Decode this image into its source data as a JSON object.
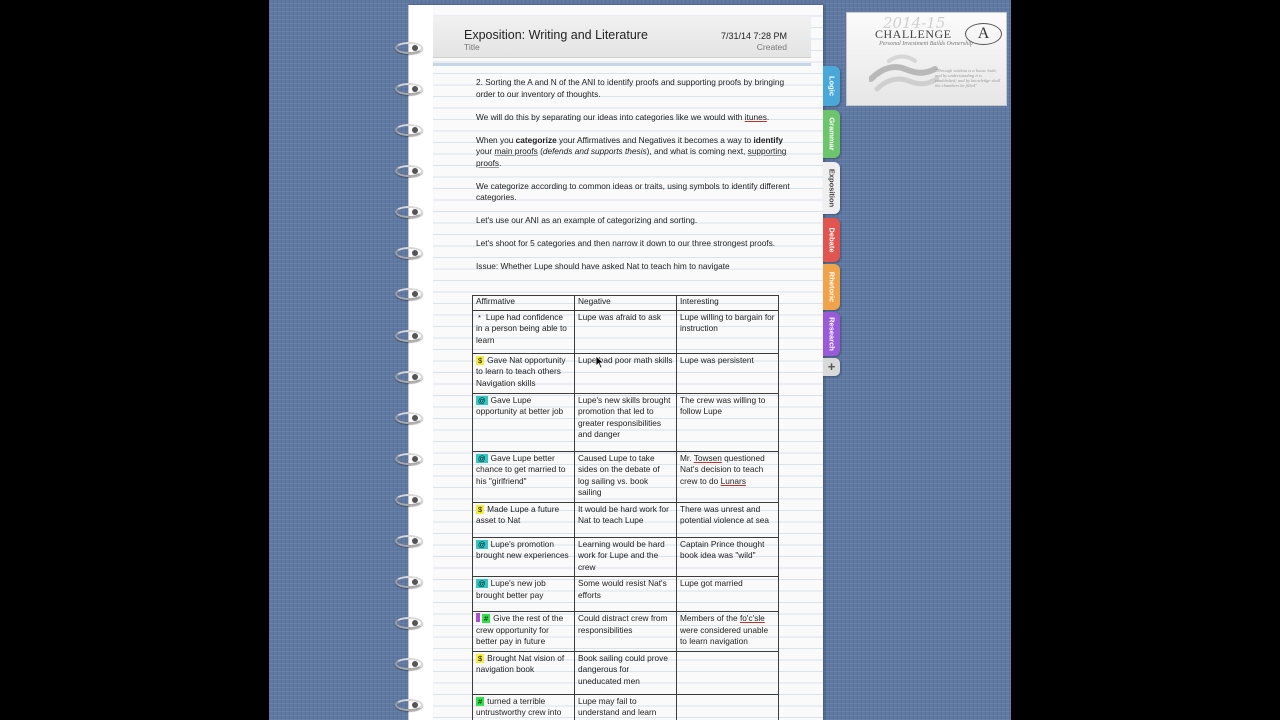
{
  "note": {
    "title": "Exposition:  Writing and Literature",
    "title_label": "Title",
    "created_value": "7/31/14 7:28 PM",
    "created_label": "Created"
  },
  "body": {
    "p1": "2.  Sorting the A and N of the ANI to identify proofs and supporting proofs by bringing order to our inventory of thoughts.",
    "p2_a": "We will do this by separating our ideas into categories like we would with ",
    "p2_b": "itunes",
    "p2_c": ".",
    "p3_a": "When you ",
    "p3_b": "categorize",
    "p3_c": " your Affirmatives and Negatives it becomes a way to ",
    "p3_d": "identify",
    "p3_e": " your ",
    "p3_f": "main proofs",
    "p3_g": " (",
    "p3_h": "defends and supports thesis",
    "p3_i": "), and what is coming next, ",
    "p3_j": "supporting proofs",
    "p3_k": ".",
    "p4": "We categorize according to common ideas or traits, using symbols to identify different categories.",
    "p5": "Let's use our ANI as an example of categorizing and sorting.",
    "p6": "Let's shoot for 5 categories and then narrow it down to our three strongest proofs.",
    "issue": "Issue:  Whether Lupe should have asked Nat to teach him to navigate"
  },
  "table": {
    "headers": [
      "Affirmative",
      "Negative",
      "Interesting"
    ],
    "rows": [
      {
        "a_sym": "*",
        "a": "Lupe had confidence in a person being able to learn",
        "n": "Lupe was afraid to ask",
        "i": "Lupe willing to bargain for instruction"
      },
      {
        "a_sym": "$",
        "a": "Gave Nat opportunity to learn to teach others Navigation skills",
        "n": "Lupe had poor math skills",
        "i": "Lupe was persistent"
      },
      {
        "a_sym": "@",
        "a": "Gave Lupe opportunity at better job",
        "n": "Lupe's new skills brought promotion that led to greater responsibilities and danger",
        "i": "The crew was willing to follow Lupe"
      },
      {
        "a_sym": "@",
        "a": "Gave Lupe better chance to get married to his \"girlfriend\"",
        "n": "Caused Lupe to take sides on the debate of log sailing vs. book sailing",
        "i_a": "Mr. ",
        "i_b": "Towsen",
        "i_c": " questioned Nat's decision to teach crew to do ",
        "i_d": "Lunars"
      },
      {
        "a_sym": "$",
        "a": "Made Lupe a future asset to Nat",
        "n": "It would be hard work for Nat to teach Lupe",
        "i": "There was unrest and potential violence at sea"
      },
      {
        "a_sym": "@",
        "a": "Lupe's promotion brought new experiences",
        "n": "Learning would be hard work for Lupe and the crew",
        "i": "Captain Prince thought book idea was \"wild\""
      },
      {
        "a_sym": "@",
        "a": "Lupe's new job brought better pay",
        "n": "Some would resist Nat's efforts",
        "i": "Lupe got married"
      },
      {
        "a_sym": "#",
        "a": "Give the rest of the crew opportunity for better pay in future",
        "n": "Could distract crew from responsibilities",
        "i_a": "Members of the ",
        "i_b": "fo'c'sle",
        "i_c": " were considered unable to learn navigation"
      },
      {
        "a_sym": "$",
        "a": "Brought Nat vision of navigation book",
        "n": "Book sailing could prove dangerous for uneducated men",
        "i": ""
      },
      {
        "a_sym": "#",
        "a": "turned a terrible untrustworthy crew into",
        "n": "Lupe may fail to understand and learn",
        "i": ""
      }
    ]
  },
  "tabs": [
    {
      "label": "Logic",
      "color": "#4aa8d8"
    },
    {
      "label": "Grammar",
      "color": "#6cc46c"
    },
    {
      "label": "Exposition",
      "color": "#efefef"
    },
    {
      "label": "Debate",
      "color": "#e0554f"
    },
    {
      "label": "Rhetoric",
      "color": "#f0a34a"
    },
    {
      "label": "Research",
      "color": "#9a5bd8"
    }
  ],
  "add_tab": "+",
  "logo": {
    "year": "2014-15",
    "word": "CHALLENGE",
    "letter": "A",
    "subtitle": "Personal Investment Builds Ownership",
    "quote": "\"Through wisdom is a house built; and by understanding it is established; and by knowledge shall the chambers be filled\""
  }
}
